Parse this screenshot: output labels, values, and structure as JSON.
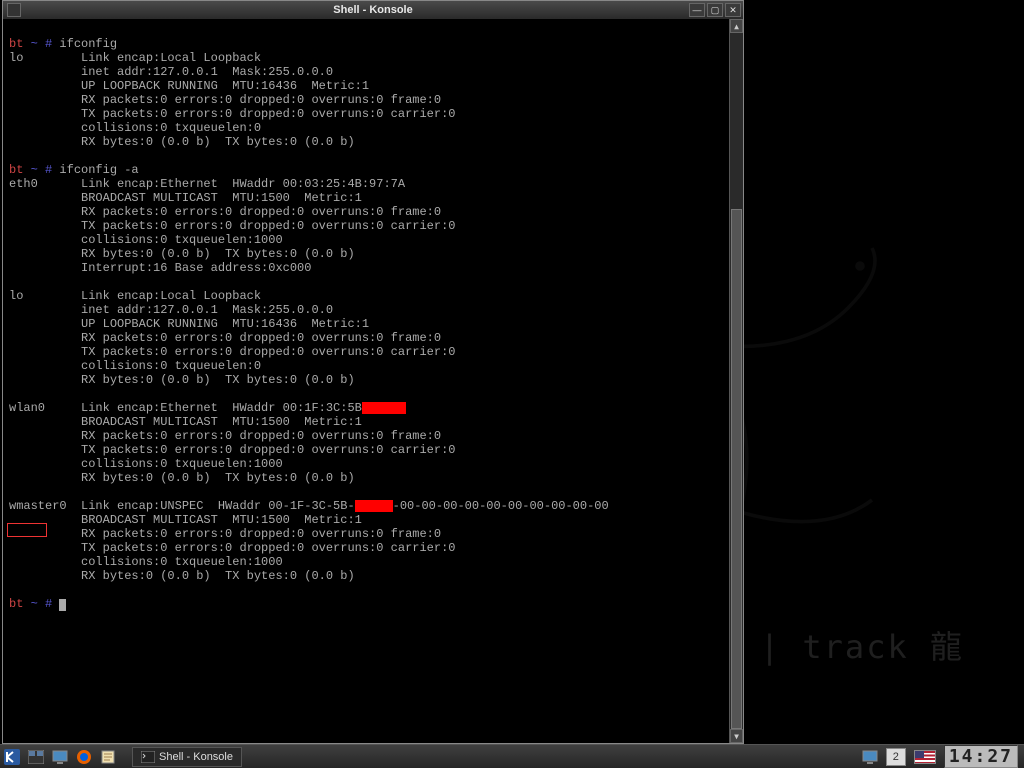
{
  "window": {
    "title": "Shell - Konsole"
  },
  "terminal": {
    "prompt_bt": "bt",
    "prompt_path": " ~ # ",
    "cmd1": "ifconfig",
    "lo1_l1": "lo        Link encap:Local Loopback",
    "lo1_l2": "          inet addr:127.0.0.1  Mask:255.0.0.0",
    "lo1_l3": "          UP LOOPBACK RUNNING  MTU:16436  Metric:1",
    "lo1_l4": "          RX packets:0 errors:0 dropped:0 overruns:0 frame:0",
    "lo1_l5": "          TX packets:0 errors:0 dropped:0 overruns:0 carrier:0",
    "lo1_l6": "          collisions:0 txqueuelen:0",
    "lo1_l7": "          RX bytes:0 (0.0 b)  TX bytes:0 (0.0 b)",
    "cmd2": "ifconfig -a",
    "eth0_l1": "eth0      Link encap:Ethernet  HWaddr 00:03:25:4B:97:7A",
    "eth0_l2": "          BROADCAST MULTICAST  MTU:1500  Metric:1",
    "eth0_l3": "          RX packets:0 errors:0 dropped:0 overruns:0 frame:0",
    "eth0_l4": "          TX packets:0 errors:0 dropped:0 overruns:0 carrier:0",
    "eth0_l5": "          collisions:0 txqueuelen:1000",
    "eth0_l6": "          RX bytes:0 (0.0 b)  TX bytes:0 (0.0 b)",
    "eth0_l7": "          Interrupt:16 Base address:0xc000",
    "lo2_l1": "lo        Link encap:Local Loopback",
    "lo2_l2": "          inet addr:127.0.0.1  Mask:255.0.0.0",
    "lo2_l3": "          UP LOOPBACK RUNNING  MTU:16436  Metric:1",
    "lo2_l4": "          RX packets:0 errors:0 dropped:0 overruns:0 frame:0",
    "lo2_l5": "          TX packets:0 errors:0 dropped:0 overruns:0 carrier:0",
    "lo2_l6": "          collisions:0 txqueuelen:0",
    "lo2_l7": "          RX bytes:0 (0.0 b)  TX bytes:0 (0.0 b)",
    "wlan0_l1a": "wlan0     Link encap:Ethernet  HWaddr 00:1F:3C:5B",
    "wlan0_l2": "          BROADCAST MULTICAST  MTU:1500  Metric:1",
    "wlan0_l3": "          RX packets:0 errors:0 dropped:0 overruns:0 frame:0",
    "wlan0_l4": "          TX packets:0 errors:0 dropped:0 overruns:0 carrier:0",
    "wlan0_l5": "          collisions:0 txqueuelen:1000",
    "wlan0_l6": "          RX bytes:0 (0.0 b)  TX bytes:0 (0.0 b)",
    "wmaster0_l1a": "wmaster0  Link encap:UNSPEC  HWaddr 00-1F-3C-5B-",
    "wmaster0_l1b": "-00-00-00-00-00-00-00-00-00-00",
    "wmaster0_l2": "          BROADCAST MULTICAST  MTU:1500  Metric:1",
    "wmaster0_l3": "          RX packets:0 errors:0 dropped:0 overruns:0 frame:0",
    "wmaster0_l4": "          TX packets:0 errors:0 dropped:0 overruns:0 carrier:0",
    "wmaster0_l5": "          collisions:0 txqueuelen:1000",
    "wmaster0_l6": "          RX bytes:0 (0.0 b)  TX bytes:0 (0.0 b)"
  },
  "desktop": {
    "bt_text": "<< back | track 龍"
  },
  "taskbar": {
    "task_label": "Shell - Konsole",
    "desktop_num": "2",
    "clock": "14:27"
  }
}
